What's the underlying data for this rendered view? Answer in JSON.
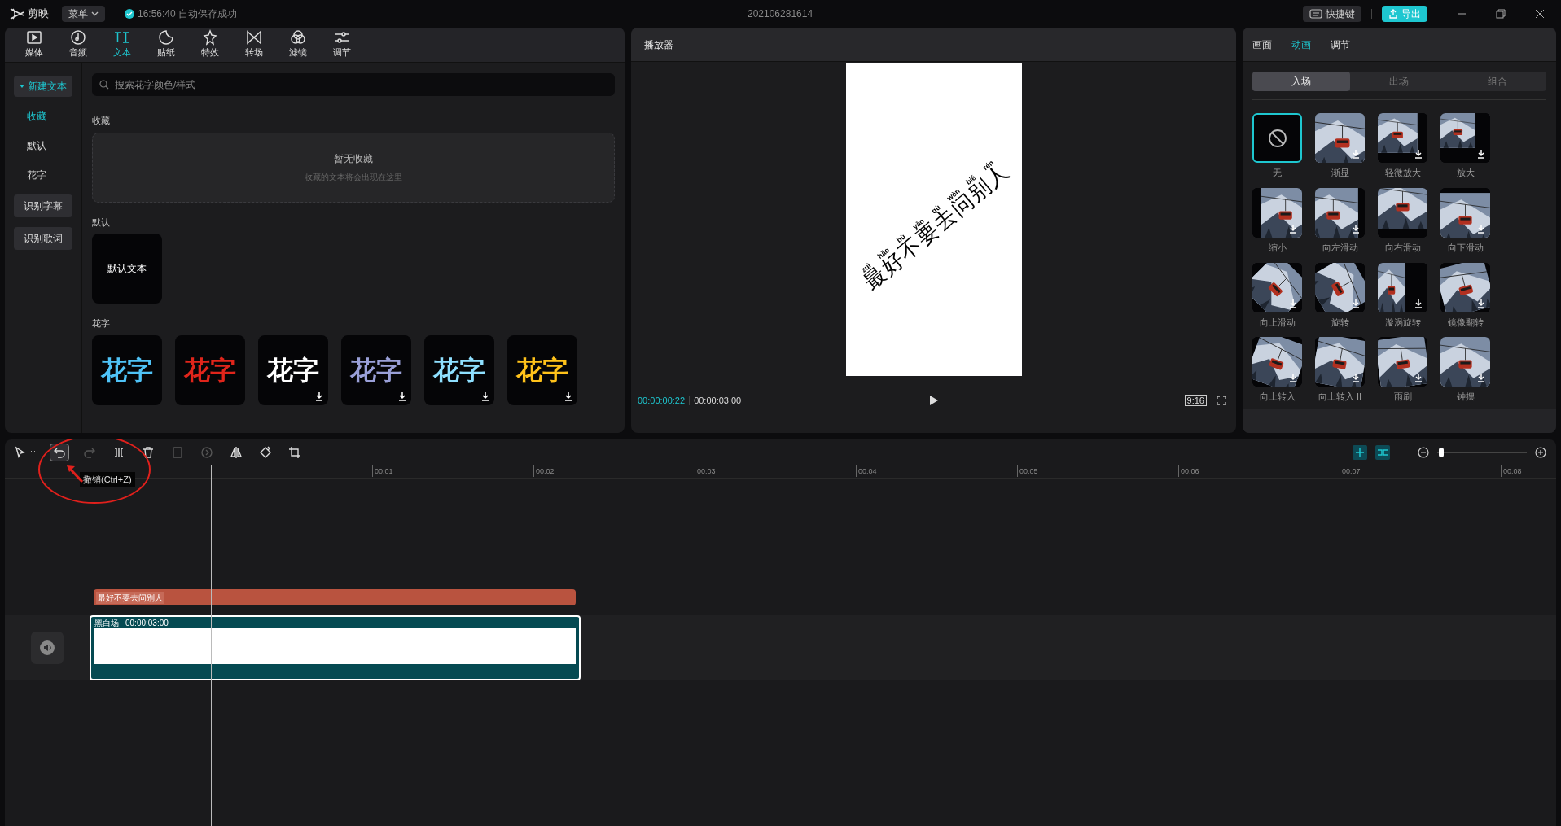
{
  "app": {
    "name": "剪映",
    "menu": "菜单",
    "save_status": "16:56:40 自动保存成功",
    "project_title": "202106281614",
    "shortcuts": "快捷键",
    "export": "导出"
  },
  "media_tabs": [
    {
      "label": "媒体",
      "selected": false
    },
    {
      "label": "音频",
      "selected": false
    },
    {
      "label": "文本",
      "selected": true
    },
    {
      "label": "贴纸",
      "selected": false
    },
    {
      "label": "特效",
      "selected": false
    },
    {
      "label": "转场",
      "selected": false
    },
    {
      "label": "滤镜",
      "selected": false
    },
    {
      "label": "调节",
      "selected": false
    }
  ],
  "text_nav": [
    {
      "label": "新建文本",
      "kind": "group",
      "selected": true
    },
    {
      "label": "收藏",
      "kind": "link",
      "selected": true
    },
    {
      "label": "默认",
      "kind": "link",
      "selected": false
    },
    {
      "label": "花字",
      "kind": "link",
      "selected": false
    },
    {
      "label": "识别字幕",
      "kind": "button",
      "selected": false
    },
    {
      "label": "识别歌词",
      "kind": "button",
      "selected": false
    }
  ],
  "search": {
    "placeholder": "搜索花字颜色/样式"
  },
  "favorites": {
    "title": "收藏",
    "empty_title": "暂无收藏",
    "empty_hint": "收藏的文本将会出现在这里"
  },
  "defaults": {
    "title": "默认",
    "items": [
      "默认文本"
    ]
  },
  "fancy": {
    "title": "花字",
    "items": [
      {
        "text": "花字",
        "color": "#4fc3f7",
        "download": false
      },
      {
        "text": "花字",
        "color": "#e0251b",
        "download": false
      },
      {
        "text": "花字",
        "color": "#ffffff",
        "download": true
      },
      {
        "text": "花字",
        "color": "#9aa0d8",
        "download": true
      },
      {
        "text": "花字",
        "color": "#8fe0ff",
        "download": true
      },
      {
        "text": "花字",
        "color": "#ffc21a",
        "download": true
      }
    ]
  },
  "player": {
    "title": "播放器",
    "current": "00:00:00:22",
    "total": "00:00:03:00",
    "ratio": "9:16",
    "caption": [
      {
        "char": "最",
        "pinyin": "zuì"
      },
      {
        "char": "好",
        "pinyin": "hǎo"
      },
      {
        "char": "不",
        "pinyin": "bù"
      },
      {
        "char": "要",
        "pinyin": "yào"
      },
      {
        "char": "去",
        "pinyin": "qù"
      },
      {
        "char": "问",
        "pinyin": "wèn"
      },
      {
        "char": "别",
        "pinyin": "bié"
      },
      {
        "char": "人",
        "pinyin": "rén"
      }
    ]
  },
  "inspector": {
    "tabs": [
      {
        "label": "画面",
        "selected": false
      },
      {
        "label": "动画",
        "selected": true
      },
      {
        "label": "调节",
        "selected": false
      }
    ],
    "subtabs": [
      {
        "label": "入场",
        "selected": true
      },
      {
        "label": "出场",
        "selected": false
      },
      {
        "label": "组合",
        "selected": false
      }
    ],
    "effects": [
      {
        "label": "无",
        "kind": "none",
        "selected": true,
        "download": false
      },
      {
        "label": "渐显",
        "kind": "picture",
        "selected": false,
        "download": true
      },
      {
        "label": "轻微放大",
        "kind": "picture",
        "selected": false,
        "download": true
      },
      {
        "label": "放大",
        "kind": "picture",
        "selected": false,
        "download": true
      },
      {
        "label": "缩小",
        "kind": "picture",
        "selected": false,
        "download": true
      },
      {
        "label": "向左滑动",
        "kind": "picture",
        "selected": false,
        "download": true
      },
      {
        "label": "向右滑动",
        "kind": "picture",
        "selected": false,
        "download": false
      },
      {
        "label": "向下滑动",
        "kind": "picture",
        "selected": false,
        "download": true
      },
      {
        "label": "向上滑动",
        "kind": "picture",
        "selected": false,
        "download": true
      },
      {
        "label": "旋转",
        "kind": "picture",
        "selected": false,
        "download": true
      },
      {
        "label": "漩涡旋转",
        "kind": "picture",
        "selected": false,
        "download": true
      },
      {
        "label": "镜像翻转",
        "kind": "picture",
        "selected": false,
        "download": true
      },
      {
        "label": "向上转入",
        "kind": "picture",
        "selected": false,
        "download": true
      },
      {
        "label": "向上转入 II",
        "kind": "picture",
        "selected": false,
        "download": true
      },
      {
        "label": "雨刷",
        "kind": "picture",
        "selected": false,
        "download": true
      },
      {
        "label": "钟摆",
        "kind": "picture",
        "selected": false,
        "download": true
      }
    ]
  },
  "timeline": {
    "tools": [
      {
        "kind": "select",
        "disabled": false,
        "hovered": false
      },
      {
        "kind": "undo",
        "disabled": false,
        "hovered": true
      },
      {
        "kind": "redo",
        "disabled": true,
        "hovered": false
      },
      {
        "kind": "split",
        "disabled": false,
        "hovered": false
      },
      {
        "kind": "delete",
        "disabled": false,
        "hovered": false
      },
      {
        "kind": "freeze",
        "disabled": true,
        "hovered": false
      },
      {
        "kind": "reverse",
        "disabled": true,
        "hovered": false
      },
      {
        "kind": "mirror",
        "disabled": false,
        "hovered": false
      },
      {
        "kind": "rotate",
        "disabled": false,
        "hovered": false
      },
      {
        "kind": "crop",
        "disabled": false,
        "hovered": false
      }
    ],
    "tooltip": "撤销(Ctrl+Z)",
    "zoom": {
      "level": 0.02
    },
    "ruler": [
      "00:01",
      "00:02",
      "00:03",
      "00:04",
      "00:05",
      "00:06",
      "00:07",
      "00:08"
    ],
    "text_clip": {
      "label": "最好不要去问别人"
    },
    "video_clip": {
      "name": "黑白场",
      "duration": "00:00:03:00"
    }
  }
}
